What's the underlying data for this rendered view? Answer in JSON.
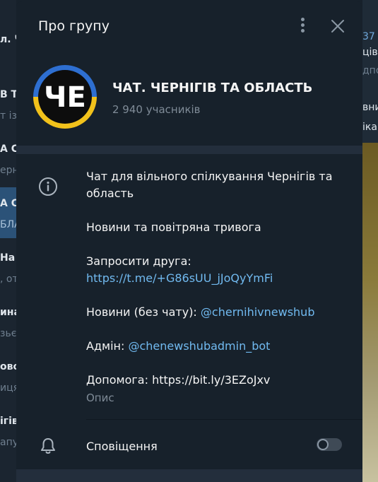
{
  "dialog": {
    "title": "Про групу"
  },
  "group": {
    "name": "ЧАТ. ЧЕРНІГІВ ТА ОБЛАСТЬ",
    "members": "2 940 учасників",
    "avatar_text": "ЧЕ"
  },
  "info": {
    "description_line1": "Чат для вільного спілкування Чернігів та",
    "description_line2": "область",
    "line_news_alert": "Новини та повітряна тривога",
    "invite_label": "Запросити друга:",
    "invite_link": "https://t.me/+G86sUU_jJoQyYmFi",
    "news_label": "Новини (без чату): ",
    "news_handle": "@chernihivnewshub",
    "admin_label": "Адмін: ",
    "admin_handle": "@chenewshubadmin_bot",
    "help_line": "Допомога: https://bit.ly/3EZoJxv",
    "caption": "Опис"
  },
  "notifications": {
    "label": "Сповіщення",
    "enabled": false
  },
  "background": {
    "left_fragments": [
      "л. Ч",
      "В Т",
      "т із",
      "А С",
      "ерн",
      "А С",
      "БЛА",
      "На",
      ", от",
      "ина",
      "зьє",
      "ово",
      "иця",
      "ігів",
      "апу"
    ],
    "right_fragments": [
      "37",
      "цiв",
      "дпо",
      "вни",
      "іка"
    ]
  },
  "colors": {
    "dialog_bg": "#17212b",
    "separator": "#232e3c",
    "link": "#71baf0",
    "secondary_text": "#7f8b97",
    "avatar_blue": "#2e6fd1",
    "avatar_yellow": "#f2c21b"
  }
}
